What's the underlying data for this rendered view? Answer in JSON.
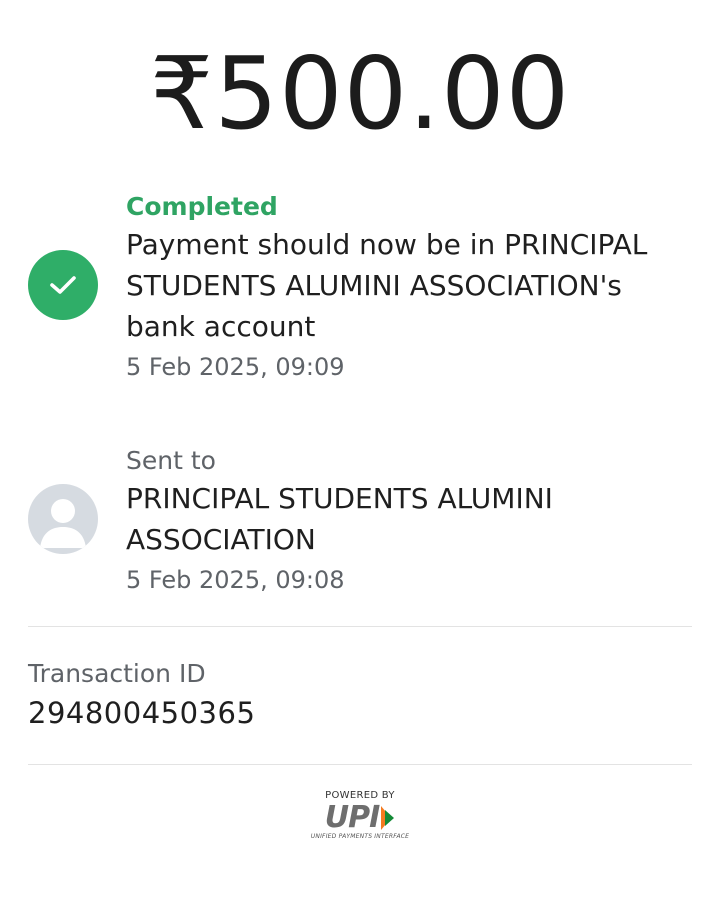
{
  "amount": "₹500.00",
  "status": {
    "label": "Completed",
    "message": "Payment should now be in PRINCIPAL STUDENTS ALUMINI ASSOCIATION's bank account",
    "timestamp": "5 Feb 2025, 09:09",
    "icon": "check-icon",
    "color": "#2fae68"
  },
  "recipient": {
    "label": "Sent to",
    "name": "PRINCIPAL STUDENTS ALUMINI ASSOCIATION",
    "timestamp": "5 Feb 2025, 09:08",
    "icon": "person-icon"
  },
  "transaction": {
    "label": "Transaction ID",
    "id": "294800450365"
  },
  "footer": {
    "powered_by": "POWERED BY",
    "brand": "UPI",
    "tagline": "UNIFIED PAYMENTS INTERFACE"
  }
}
